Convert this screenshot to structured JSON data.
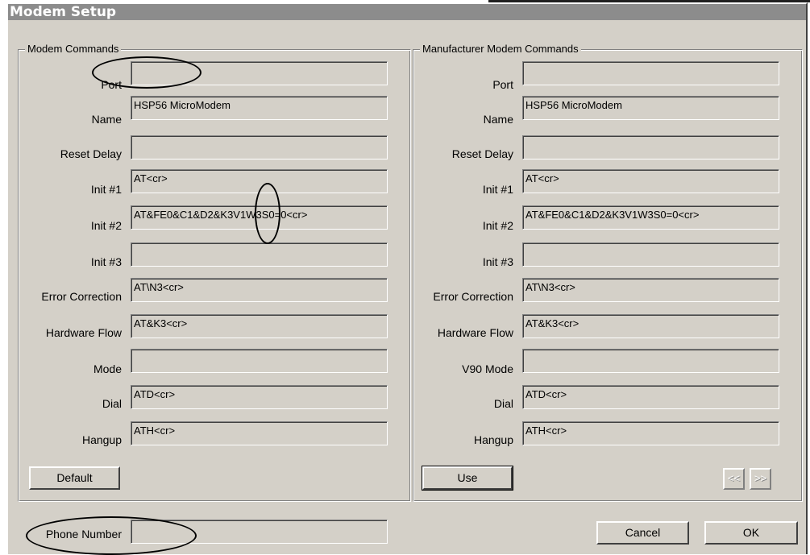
{
  "window": {
    "title": "Modem Setup"
  },
  "left_group": {
    "title": "Modem Commands",
    "rows": [
      {
        "label": "Port",
        "value": ""
      },
      {
        "label": "Name",
        "value": "HSP56 MicroModem"
      },
      {
        "label": "Reset Delay",
        "value": ""
      },
      {
        "label": "Init #1",
        "value": "AT<cr>"
      },
      {
        "label": "Init #2",
        "value": "AT&FE0&C1&D2&K3V1W3S0=0<cr>"
      },
      {
        "label": "Init #3",
        "value": ""
      },
      {
        "label": "Error Correction",
        "value": "AT\\N3<cr>"
      },
      {
        "label": "Hardware Flow",
        "value": "AT&K3<cr>"
      },
      {
        "label": "Mode",
        "value": ""
      },
      {
        "label": "Dial",
        "value": "ATD<cr>"
      },
      {
        "label": "Hangup",
        "value": "ATH<cr>"
      }
    ],
    "default_button": "Default"
  },
  "right_group": {
    "title": "Manufacturer Modem Commands",
    "rows": [
      {
        "label": "Port",
        "value": ""
      },
      {
        "label": "Name",
        "value": "HSP56 MicroModem"
      },
      {
        "label": "Reset Delay",
        "value": ""
      },
      {
        "label": "Init #1",
        "value": "AT<cr>"
      },
      {
        "label": "Init #2",
        "value": "AT&FE0&C1&D2&K3V1W3S0=0<cr>"
      },
      {
        "label": "Init #3",
        "value": ""
      },
      {
        "label": "Error Correction",
        "value": "AT\\N3<cr>"
      },
      {
        "label": "Hardware Flow",
        "value": "AT&K3<cr>"
      },
      {
        "label": "V90 Mode",
        "value": ""
      },
      {
        "label": "Dial",
        "value": "ATD<cr>"
      },
      {
        "label": "Hangup",
        "value": "ATH<cr>"
      }
    ],
    "use_button": "Use",
    "prev_button": "<<",
    "next_button": ">>"
  },
  "phone": {
    "label": "Phone Number",
    "value": ""
  },
  "buttons": {
    "cancel": "Cancel",
    "ok": "OK"
  }
}
